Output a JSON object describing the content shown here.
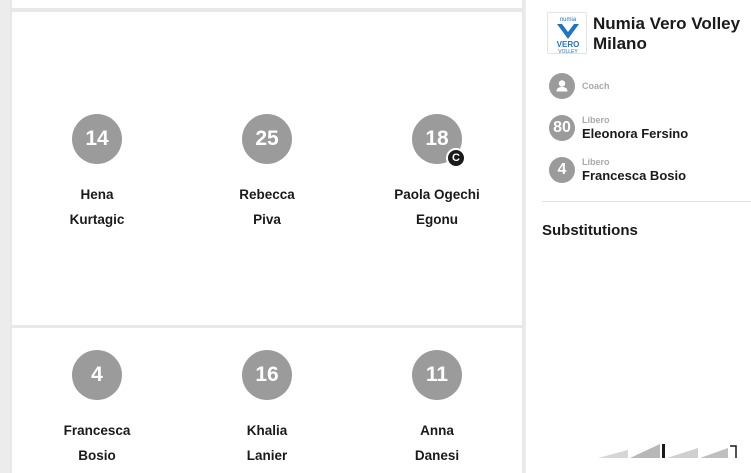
{
  "court": {
    "front_row": [
      {
        "number": "14",
        "first": "Hena",
        "last": "Kurtagic",
        "captain": false
      },
      {
        "number": "25",
        "first": "Rebecca",
        "last": "Piva",
        "captain": false
      },
      {
        "number": "18",
        "first": "Paola Ogechi",
        "last": "Egonu",
        "captain": true,
        "badge": "C"
      }
    ],
    "back_row": [
      {
        "number": "4",
        "first": "Francesca",
        "last": "Bosio",
        "captain": false
      },
      {
        "number": "16",
        "first": "Khalia",
        "last": "Lanier",
        "captain": false
      },
      {
        "number": "11",
        "first": "Anna",
        "last": "Danesi",
        "captain": false
      }
    ]
  },
  "team": {
    "name": "Numia Vero Volley Milano",
    "logo_text_top": "numia",
    "logo_text_main": "VERO",
    "logo_text_sub": "VOLLEY",
    "logo_color": "#1f74c4"
  },
  "staff": [
    {
      "role": "Coach",
      "name": "",
      "icon": "person-icon"
    },
    {
      "role": "Libero",
      "name": "Eleonora Fersino",
      "number": "80"
    },
    {
      "role": "Libero",
      "name": "Francesca Bosio",
      "number": "4"
    }
  ],
  "substitutions_title": "Substitutions",
  "colors": {
    "jersey": "#9b9b9b",
    "court_bg": "#e8e8e8",
    "captain_badge": "#1a1a1a"
  }
}
